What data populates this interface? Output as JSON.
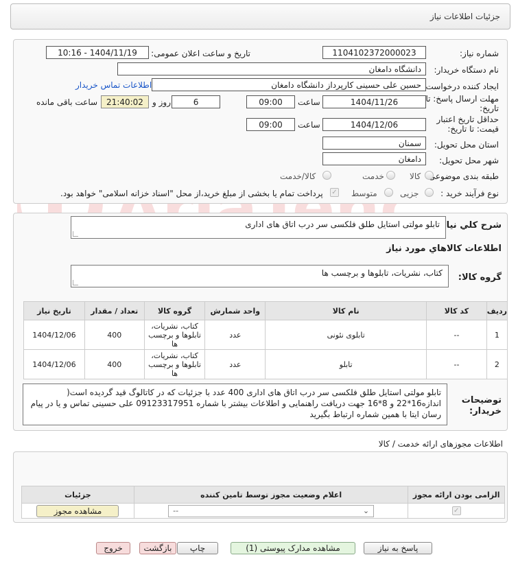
{
  "header": {
    "title": "جزئیات اطلاعات نیاز"
  },
  "form": {
    "need_number_label": "شماره نیاز:",
    "need_number": "1104102372000023",
    "announce_label": "تاریخ و ساعت اعلان عمومی:",
    "announce_value": "1404/11/19 - 10:16",
    "buyer_org_label": "نام دستگاه خریدار:",
    "buyer_org": "دانشگاه دامغان",
    "requester_label": "ایجاد کننده درخواست:",
    "requester": "حسین علی حسینی کارپرداز دانشگاه دامغان",
    "buyer_contact_link": "اطلاعات تماس خریدار",
    "deadline_label_1": "مهلت ارسال پاسخ: تا",
    "deadline_label_2": "تاریخ:",
    "deadline_date": "1404/11/26",
    "time_label": "ساعت",
    "deadline_time": "09:00",
    "days_value": "6",
    "days_label": "روز و",
    "countdown": "21:40:02",
    "remaining_label": "ساعت باقی مانده",
    "min_validity_label_1": "حداقل تاریخ اعتبار",
    "min_validity_label_2": "قیمت: تا تاریخ:",
    "validity_date": "1404/12/06",
    "validity_time": "09:00",
    "province_label": "استان محل تحویل:",
    "province": "سمنان",
    "city_label": "شهر محل تحویل:",
    "city": "دامغان",
    "category_label": "طبقه بندی موضوعی:",
    "category_options": [
      "کالا",
      "خدمت",
      "کالا/خدمت"
    ],
    "process_label": "نوع فرآیند خرید :",
    "process_options": [
      "جزیی",
      "متوسط"
    ],
    "payment_note": "پرداخت تمام یا بخشی از مبلغ خرید،از محل \"اسناد خزانه اسلامی\" خواهد بود."
  },
  "details": {
    "general_desc_label": "شرح کلي نياز:",
    "general_desc": "تابلو مولتی استایل طلق فلکسی سر درب اتاق های اداری",
    "goods_info_title": "اطلاعات کالاهاي مورد نياز",
    "goods_group_label": "گروه کالا:",
    "goods_group": "کتاب، نشریات، تابلوها و برچسب ها",
    "table_headers": [
      "ردیف",
      "کد کالا",
      "نام کالا",
      "واحد شمارش",
      "گروه کالا",
      "تعداد / مقدار",
      "تاریخ نیاز"
    ],
    "rows": [
      {
        "index": "1",
        "code": "--",
        "name": "تابلوی نئونی",
        "unit": "عدد",
        "group": "کتاب، نشریات، تابلوها و برچسب ها",
        "qty": "400",
        "date": "1404/12/06"
      },
      {
        "index": "2",
        "code": "--",
        "name": "تابلو",
        "unit": "عدد",
        "group": "کتاب، نشریات، تابلوها و برچسب ها",
        "qty": "400",
        "date": "1404/12/06"
      }
    ],
    "buyer_notes_label_1": "توضیحات",
    "buyer_notes_label_2": "خریدار:",
    "buyer_notes": "تابلو مولتی استایل طلق فلکسی سر درب اتاق های اداری 400 عدد با جزئیات که در کاتالوگ قید گردیده است( اندازه16*22 و 8*16 جهت دریافت راهنمایی و اطلاعات بیشتر با شماره 09123317951 علی حسینی تماس و یا در پیام رسان ایتا با همین شماره ارتباط بگیرید"
  },
  "permits": {
    "title": "اطلاعات مجوزهای ارائه خدمت / کالا",
    "headers": [
      "الزامی بودن ارائه مجوز",
      "اعلام وضعیت مجوز توسط تامین کننده",
      "جزئیات"
    ],
    "select_value": "--",
    "view_button": "مشاهده مجوز"
  },
  "buttons": {
    "reply": "پاسخ به نیاز",
    "attachments": "مشاهده مدارک پیوستی (1)",
    "print": "چاپ",
    "back": "بازگشت",
    "exit": "خروج"
  },
  "watermark": {
    "text": "AriaTender.neT"
  },
  "colors": {
    "link": "#1a56c8",
    "countdown_bg": "#f5f0c8",
    "attach_btn_bg": "#e4f5df",
    "back_btn_bg": "#f7dcdc",
    "watermark": "#d00000"
  }
}
